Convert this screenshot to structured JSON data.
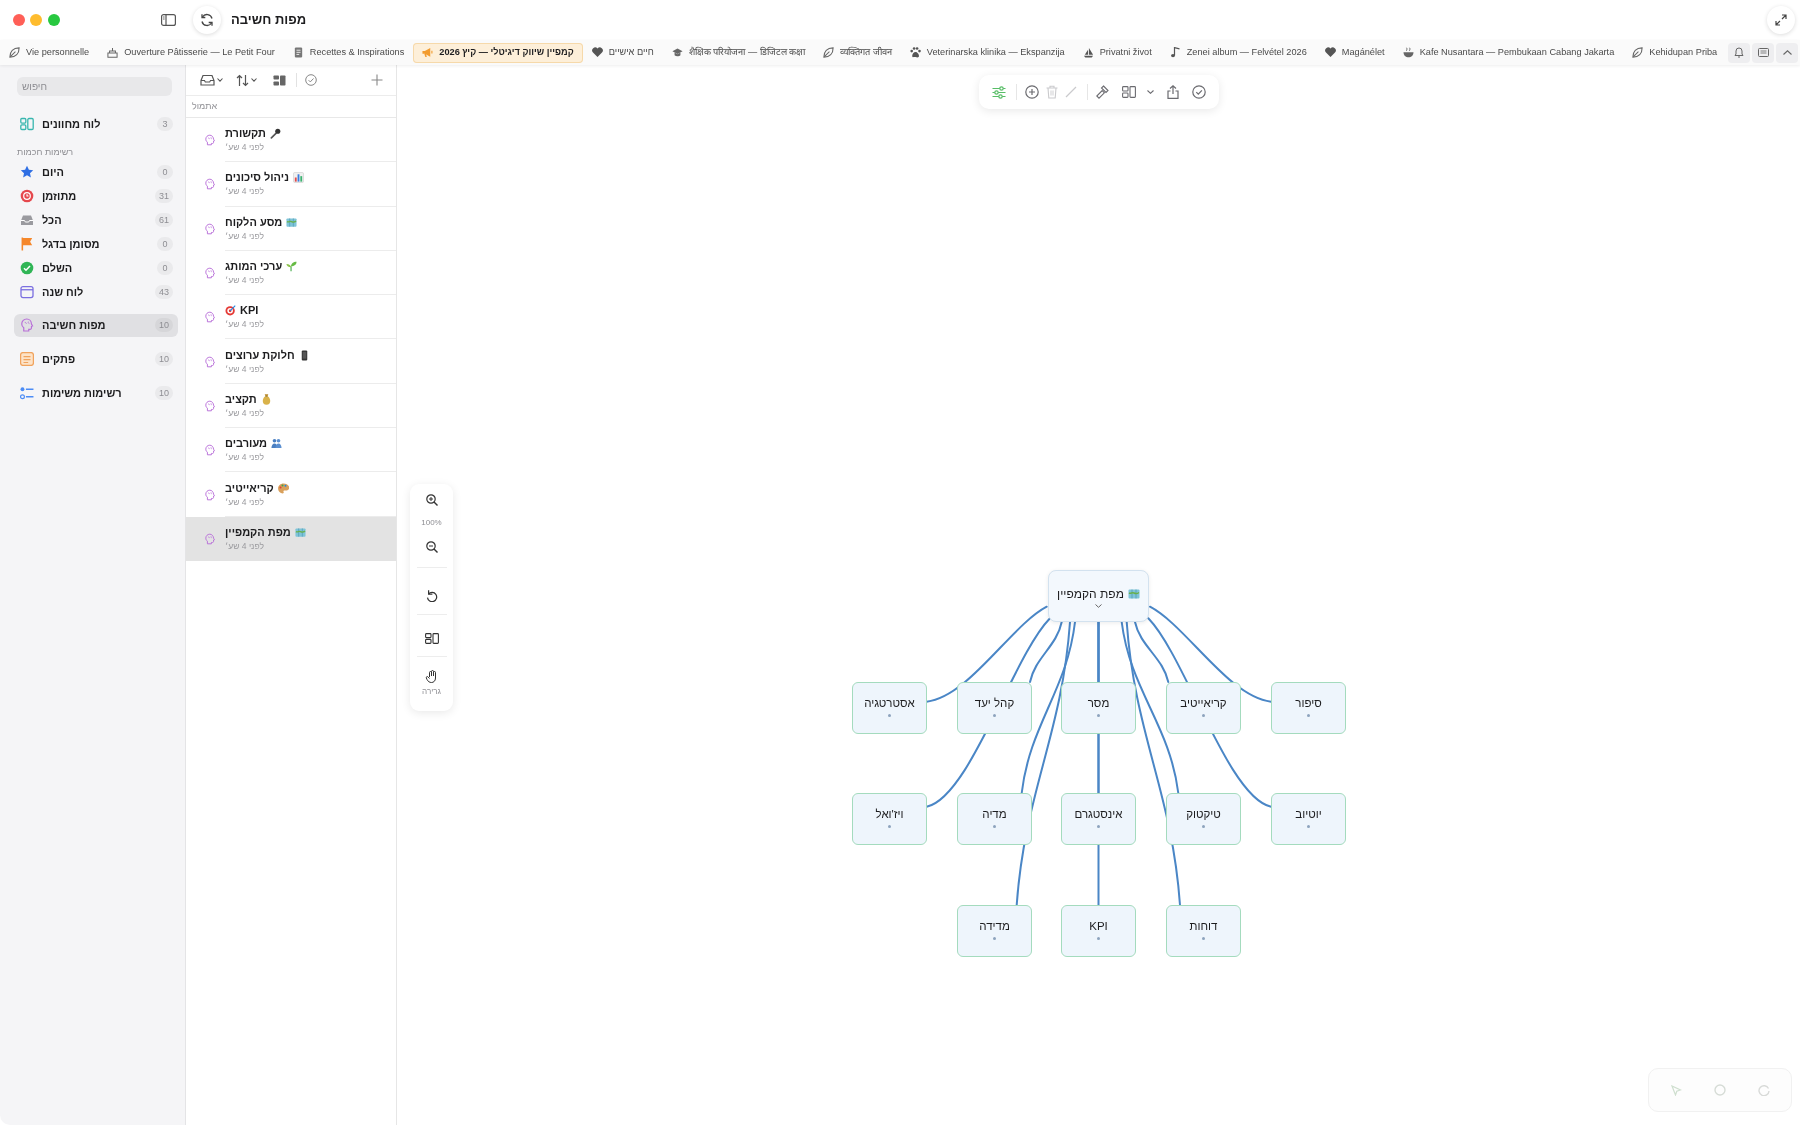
{
  "window": {
    "title": "מפות חשיבה"
  },
  "tabs": [
    {
      "label": "Kehidupan Priba",
      "kind": "leaf",
      "selected": false
    },
    {
      "label": "Kafe Nusantara — Pembukaan Cabang Jakarta",
      "kind": "bowl",
      "selected": false
    },
    {
      "label": "Magánélet",
      "kind": "heart",
      "selected": false
    },
    {
      "label": "Zenei album — Felvétel 2026",
      "kind": "note",
      "selected": false
    },
    {
      "label": "Privatni život",
      "kind": "boat",
      "selected": false
    },
    {
      "label": "Veterinarska klinika — Ekspanzija",
      "kind": "paw",
      "selected": false
    },
    {
      "label": "व्यक्तिगत जीवन",
      "kind": "leaf",
      "selected": false
    },
    {
      "label": "शैक्षिक परियोजना — डिजिटल कक्षा",
      "kind": "cap",
      "selected": false
    },
    {
      "label": "חיים אישיים",
      "kind": "heart",
      "selected": false
    },
    {
      "label": "קמפיין שיווק דיגיטלי — קיץ 2026",
      "kind": "megaphone",
      "selected": true
    },
    {
      "label": "Recettes & Inspirations",
      "kind": "document",
      "selected": false
    },
    {
      "label": "Ouverture Pâtisserie — Le Petit Four",
      "kind": "cake",
      "selected": false
    },
    {
      "label": "Vie personnelle",
      "kind": "leaf",
      "selected": false
    }
  ],
  "sidebar": {
    "search": {
      "placeholder": "חיפוש"
    },
    "dashboard": {
      "label": "לוח מחוונים",
      "count": "3",
      "kind": "dashboard",
      "selected": false
    },
    "smart_lists": {
      "title": "רשימות חכמות",
      "items": [
        {
          "label": "היום",
          "count": "0",
          "kind": "today",
          "selected": false
        },
        {
          "label": "מתוזמן",
          "count": "31",
          "kind": "scheduled",
          "selected": false
        },
        {
          "label": "הכל",
          "count": "61",
          "kind": "all",
          "selected": false
        },
        {
          "label": "מסומן בדגל",
          "count": "0",
          "kind": "flagged",
          "selected": false
        },
        {
          "label": "השלם",
          "count": "0",
          "kind": "completed",
          "selected": false
        },
        {
          "label": "לוח שנה",
          "count": "43",
          "kind": "calendar",
          "selected": false
        }
      ]
    },
    "sections": [
      {
        "label": "מפות חשיבה",
        "count": "10",
        "kind": "mindmaps",
        "selected": true
      },
      {
        "label": "פתקים",
        "count": "10",
        "kind": "notes",
        "selected": false
      },
      {
        "label": "רשימות משימות",
        "count": "10",
        "kind": "tasks",
        "selected": false
      }
    ]
  },
  "note_list": {
    "group_title": "אתמול",
    "items": [
      {
        "title": "תקשורת",
        "kind": "microphone",
        "time": "לפני 4 שע׳",
        "selected": false
      },
      {
        "title": "ניהול סיכונים",
        "kind": "chart",
        "time": "לפני 4 שע׳",
        "selected": false
      },
      {
        "title": "מסע הלקוח",
        "kind": "map",
        "time": "לפני 4 שע׳",
        "selected": false
      },
      {
        "title": "ערכי המותג",
        "kind": "sprout",
        "time": "לפני 4 שע׳",
        "selected": false
      },
      {
        "title": "KPI",
        "kind": "target",
        "time": "לפני 4 שע׳",
        "selected": false
      },
      {
        "title": "חלוקת ערוצים",
        "kind": "phone",
        "time": "לפני 4 שע׳",
        "selected": false
      },
      {
        "title": "תקציב",
        "kind": "moneybag",
        "time": "לפני 4 שע׳",
        "selected": false
      },
      {
        "title": "מעורבים",
        "kind": "people",
        "time": "לפני 4 שע׳",
        "selected": false
      },
      {
        "title": "קריאייטיב",
        "kind": "palette",
        "time": "לפני 4 שע׳",
        "selected": false
      },
      {
        "title": "מפת הקמפיין",
        "kind": "map",
        "time": "לפני 4 שע׳",
        "selected": true
      }
    ]
  },
  "canvas_toolbar": [
    [
      {
        "kind": "style",
        "on": true,
        "disabled": false
      }
    ],
    [
      {
        "kind": "add",
        "on": false,
        "disabled": false
      },
      {
        "kind": "delete",
        "on": false,
        "disabled": true
      },
      {
        "kind": "connect",
        "on": false,
        "disabled": true
      }
    ],
    [
      {
        "kind": "format",
        "on": false,
        "disabled": false
      },
      {
        "kind": "layout",
        "on": false,
        "disabled": false
      },
      {
        "kind": "share",
        "on": false,
        "disabled": false
      },
      {
        "kind": "done",
        "on": false,
        "disabled": false
      }
    ]
  ],
  "zoom_panel": {
    "zoom": "100%",
    "tool_label": "גרירה"
  },
  "mind_map": {
    "root": {
      "title": "מפת הקמפיין",
      "kind": "map",
      "expanded": true,
      "children": [
        {
          "title": "סיפור"
        },
        {
          "title": "קריאייטיב"
        },
        {
          "title": "מסר"
        },
        {
          "title": "קהל יעד"
        },
        {
          "title": "אסטרטגיה"
        },
        {
          "title": "יוטיוב"
        },
        {
          "title": "טיקטוק"
        },
        {
          "title": "אינסטגרם"
        },
        {
          "title": "מדיה"
        },
        {
          "title": "ויז'ואל"
        },
        {
          "title": "דוחות"
        },
        {
          "title": "KPI"
        },
        {
          "title": "מדידה"
        }
      ]
    }
  }
}
